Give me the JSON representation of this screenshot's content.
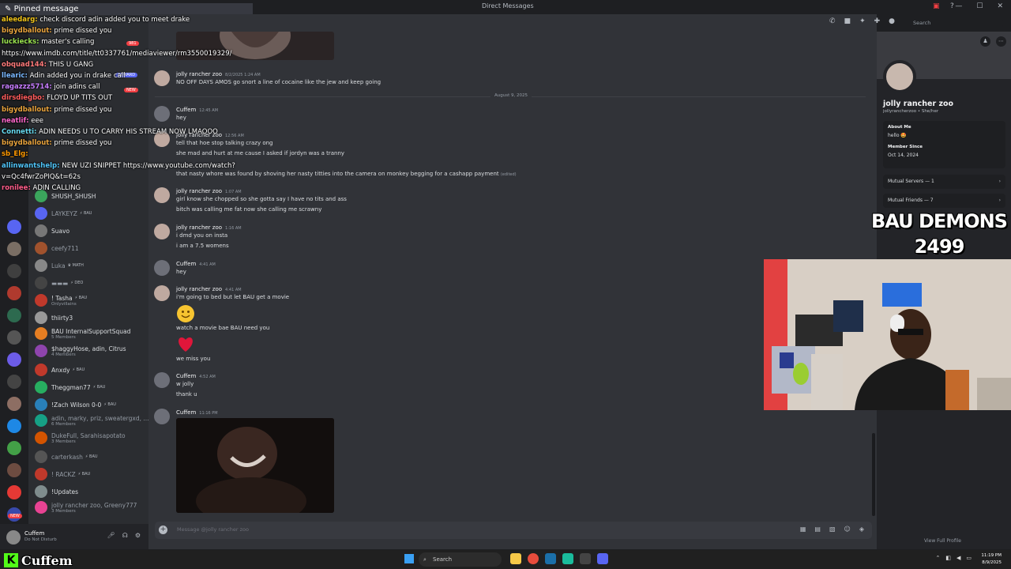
{
  "window": {
    "title": "Direct Messages"
  },
  "pinned": {
    "label": "Pinned message"
  },
  "stream_chat": [
    {
      "user": "aleedarg:",
      "text": "check discord adin added you to meet drake",
      "color": "#f0c419"
    },
    {
      "user": "bigydballout:",
      "text": "prime dissed you",
      "color": "#e8a33d"
    },
    {
      "user": "luckiecks:",
      "text": "master's calling",
      "color": "#9ae34f"
    },
    {
      "user": "",
      "text": "https://www.imdb.com/title/tt0337761/mediaviewer/rm3550019329/",
      "color": "#ffffff"
    },
    {
      "user": "obquad144:",
      "text": "THIS U GANG",
      "color": "#ff7a7a"
    },
    {
      "user": "llearic:",
      "text": "Adin added you in drake call",
      "color": "#7ab8ff"
    },
    {
      "user": "ragazzz5714:",
      "text": "join adins call",
      "color": "#c77dff"
    },
    {
      "user": "dirsdiegbo:",
      "text": "FLOYD UP TITS OUT",
      "color": "#ff5c5c"
    },
    {
      "user": "bigydballout:",
      "text": "prime dissed you",
      "color": "#e8a33d"
    },
    {
      "user": "neatlif:",
      "text": "eee",
      "color": "#ff66cc"
    },
    {
      "user": "Connetti:",
      "text": "ADIN NEEDS U TO CARRY HIS STREAM NOW LMAOOO",
      "color": "#66d9ef"
    },
    {
      "user": "bigydballout:",
      "text": "prime dissed you",
      "color": "#e8a33d"
    },
    {
      "user": "sb_Elg:",
      "text": "",
      "color": "#ff9900"
    },
    {
      "user": "allinwantshelp:",
      "text": "NEW UZI SNIPPET https://www.youtube.com/watch?",
      "color": "#4fc3f7"
    },
    {
      "user": "",
      "text": "v=Qc4fwrZoPIQ&t=62s",
      "color": "#ffffff"
    },
    {
      "user": "ronilee:",
      "text": "ADIN CALLING",
      "color": "#ff5c8a"
    }
  ],
  "dm_list": [
    {
      "name": "SHUSH_SHUSH",
      "badge": "",
      "sub": "",
      "dim": false,
      "color": "#3ba55c"
    },
    {
      "name": "LAYKEYZ",
      "badge": "⚡ BAU",
      "sub": "",
      "dim": true,
      "color": "#5865f2"
    },
    {
      "name": "Suavo",
      "badge": "",
      "sub": "",
      "dim": false,
      "color": "#777"
    },
    {
      "name": "ceefy711",
      "badge": "",
      "sub": "",
      "dim": true,
      "color": "#a0522d"
    },
    {
      "name": "Luka",
      "badge": "♛ MATH",
      "sub": "",
      "dim": true,
      "color": "#888"
    },
    {
      "name": "▬▬▬",
      "badge": "⚡ DEO",
      "sub": "",
      "dim": true,
      "color": "#444"
    },
    {
      "name": "! Tasha",
      "badge": "⚡ BAU",
      "sub": "Onlyvillains",
      "dim": false,
      "color": "#c0392b"
    },
    {
      "name": "thiirty3",
      "badge": "",
      "sub": "",
      "dim": false,
      "color": "#999"
    },
    {
      "name": "BAU InternalSupportSquad",
      "badge": "",
      "sub": "5 Members",
      "dim": false,
      "color": "#e67e22"
    },
    {
      "name": "$haggyHose, adin, Citrus",
      "badge": "",
      "sub": "4 Members",
      "dim": false,
      "color": "#8e44ad"
    },
    {
      "name": "Anxdy",
      "badge": "⚡ BAU",
      "sub": "",
      "dim": false,
      "color": "#c0392b"
    },
    {
      "name": "Theggman77",
      "badge": "⚡ BAU",
      "sub": "",
      "dim": false,
      "color": "#27ae60"
    },
    {
      "name": "!Zach Wilson 0-0",
      "badge": "⚡ BAU",
      "sub": "",
      "dim": false,
      "color": "#2980b9"
    },
    {
      "name": "adin, marky, priz, sweatergxd, ...",
      "badge": "",
      "sub": "6 Members",
      "dim": true,
      "color": "#16a085"
    },
    {
      "name": "DukeFull, Sarahisapotato",
      "badge": "",
      "sub": "3 Members",
      "dim": true,
      "color": "#d35400"
    },
    {
      "name": "carterkash",
      "badge": "⚡ BAU",
      "sub": "",
      "dim": true,
      "color": "#555"
    },
    {
      "name": "! RACKZ",
      "badge": "⚡ BAU",
      "sub": "",
      "dim": true,
      "color": "#c0392b"
    },
    {
      "name": "!Updates",
      "badge": "",
      "sub": "",
      "dim": false,
      "color": "#7f8c8d"
    },
    {
      "name": "jolly rancher zoo, Greeny777",
      "badge": "",
      "sub": "3 Members",
      "dim": true,
      "color": "#e84393"
    }
  ],
  "user_panel": {
    "name": "Cuffem",
    "status": "Do Not Disturb"
  },
  "badges": {
    "new": "NEW",
    "count1": "981",
    "reward": "REWARD"
  },
  "date_divider": "August 9, 2025",
  "messages": {
    "m1": {
      "author": "jolly rancher zoo",
      "ts": "8/2/2025 1:24 AM",
      "lines": [
        "NO OFF DAYS AMOS go snort a line of cocaine like the jew and keep going"
      ]
    },
    "m2": {
      "author": "Cuffem",
      "ts": "12:45 AM",
      "lines": [
        "hey"
      ]
    },
    "m3": {
      "author": "jolly rancher zoo",
      "ts": "12:56 AM",
      "lines": [
        "tell that hoe stop talking crazy ong",
        "she mad and hurt at me cause I asked if jordyn was a tranny"
      ]
    },
    "m3c": [
      "that nasty whore was found by shoving her nasty titties into the camera on monkey begging for a cashapp payment"
    ],
    "m3c_tag": "(edited)",
    "m4": {
      "author": "jolly rancher zoo",
      "ts": "1:07 AM",
      "lines": [
        "girl know she chopped so she gotta say I have no tits and ass",
        "bitch was calling me fat now she calling me scrawny"
      ]
    },
    "m5": {
      "author": "jolly rancher zoo",
      "ts": "1:16 AM",
      "lines": [
        "i dmd you on insta",
        "i am a 7.5 womens"
      ]
    },
    "m6": {
      "author": "Cuffem",
      "ts": "4:41 AM",
      "lines": [
        "hey"
      ]
    },
    "m7": {
      "author": "jolly rancher zoo",
      "ts": "4:41 AM",
      "lines": [
        "i'm going to bed but let BAU get a movie"
      ]
    },
    "m7c1": "watch a movie bae BAU need you",
    "m7c2": "we miss you",
    "m8": {
      "author": "Cuffem",
      "ts": "4:52 AM",
      "lines": [
        "w jolly",
        "thank u"
      ]
    },
    "m9": {
      "author": "Cuffem",
      "ts": "11:16 PM",
      "lines": []
    }
  },
  "input": {
    "placeholder": "Message @jolly rancher zoo"
  },
  "search": {
    "placeholder": "Search"
  },
  "profile": {
    "name": "jolly rancher zoo",
    "handle": "jollyrancherzoo • She/her",
    "about_label": "About Me",
    "about_value": "hello 🤩",
    "member_label": "Member Since",
    "member_value": "Oct 14, 2024",
    "mutual_servers": "Mutual Servers — 1",
    "mutual_friends": "Mutual Friends — 7",
    "view_full": "View Full Profile"
  },
  "overlay": {
    "line1": "BAU DEMONS",
    "line2": "2499"
  },
  "taskbar": {
    "search": "Search",
    "time": "11:19 PM",
    "date": "8/9/2025"
  },
  "kick": {
    "logo": "K",
    "name": "Cuffem"
  }
}
